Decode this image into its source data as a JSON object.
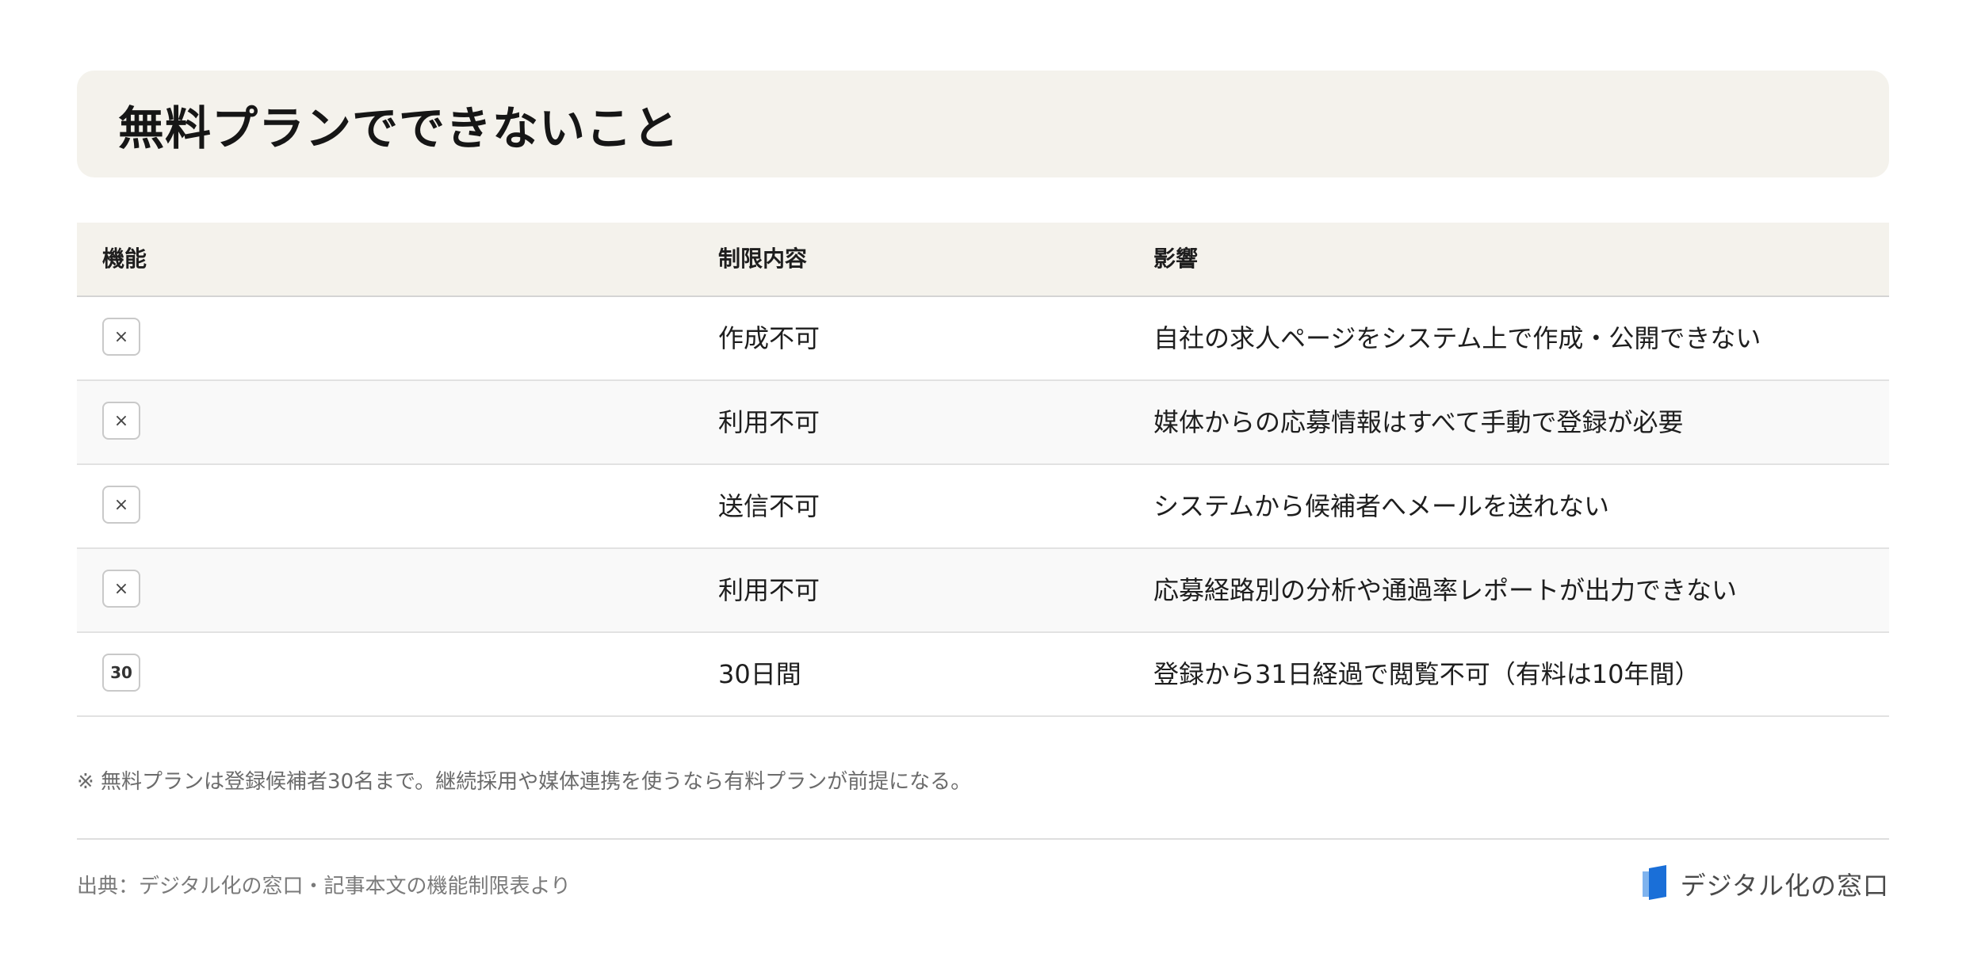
{
  "title": "無料プランでできないこと",
  "table": {
    "headers": [
      "機能",
      "制限内容",
      "影響"
    ],
    "rows": [
      {
        "badge": "×",
        "restriction": "作成不可",
        "impact": "自社の求人ページをシステム上で作成・公開できない"
      },
      {
        "badge": "×",
        "restriction": "利用不可",
        "impact": "媒体からの応募情報はすべて手動で登録が必要"
      },
      {
        "badge": "×",
        "restriction": "送信不可",
        "impact": "システムから候補者へメールを送れない"
      },
      {
        "badge": "×",
        "restriction": "利用不可",
        "impact": "応募経路別の分析や通過率レポートが出力できない"
      },
      {
        "badge": "30",
        "restriction": "30日間",
        "impact": "登録から31日経過で閲覧不可（有料は10年間）"
      }
    ]
  },
  "note": "※ 無料プランは登録候補者30名まで。継続採用や媒体連携を使うなら有料プランが前提になる。",
  "source": "出典：デジタル化の窓口・記事本文の機能制限表より",
  "brand": {
    "name": "デジタル化の窓口",
    "logo_icon": "door-logo-icon",
    "logo_color": "#1a6fd8"
  }
}
